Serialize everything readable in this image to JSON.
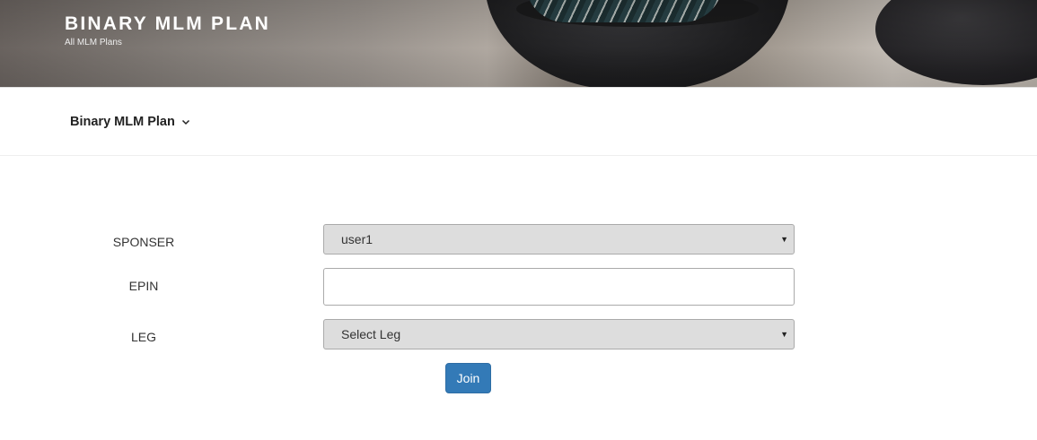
{
  "header": {
    "site_title": "BINARY MLM PLAN",
    "site_description": "All MLM Plans"
  },
  "nav": {
    "menu_item": "Binary MLM Plan",
    "menu_icon": "chevron-down-icon"
  },
  "form": {
    "sponsor": {
      "label": "SPONSER",
      "selected": "user1"
    },
    "epin": {
      "label": "EPIN",
      "value": ""
    },
    "leg": {
      "label": "LEG",
      "selected": "Select Leg"
    },
    "submit_label": "Join"
  },
  "colors": {
    "button_bg": "#337ab7",
    "select_bg": "#dddddd"
  }
}
